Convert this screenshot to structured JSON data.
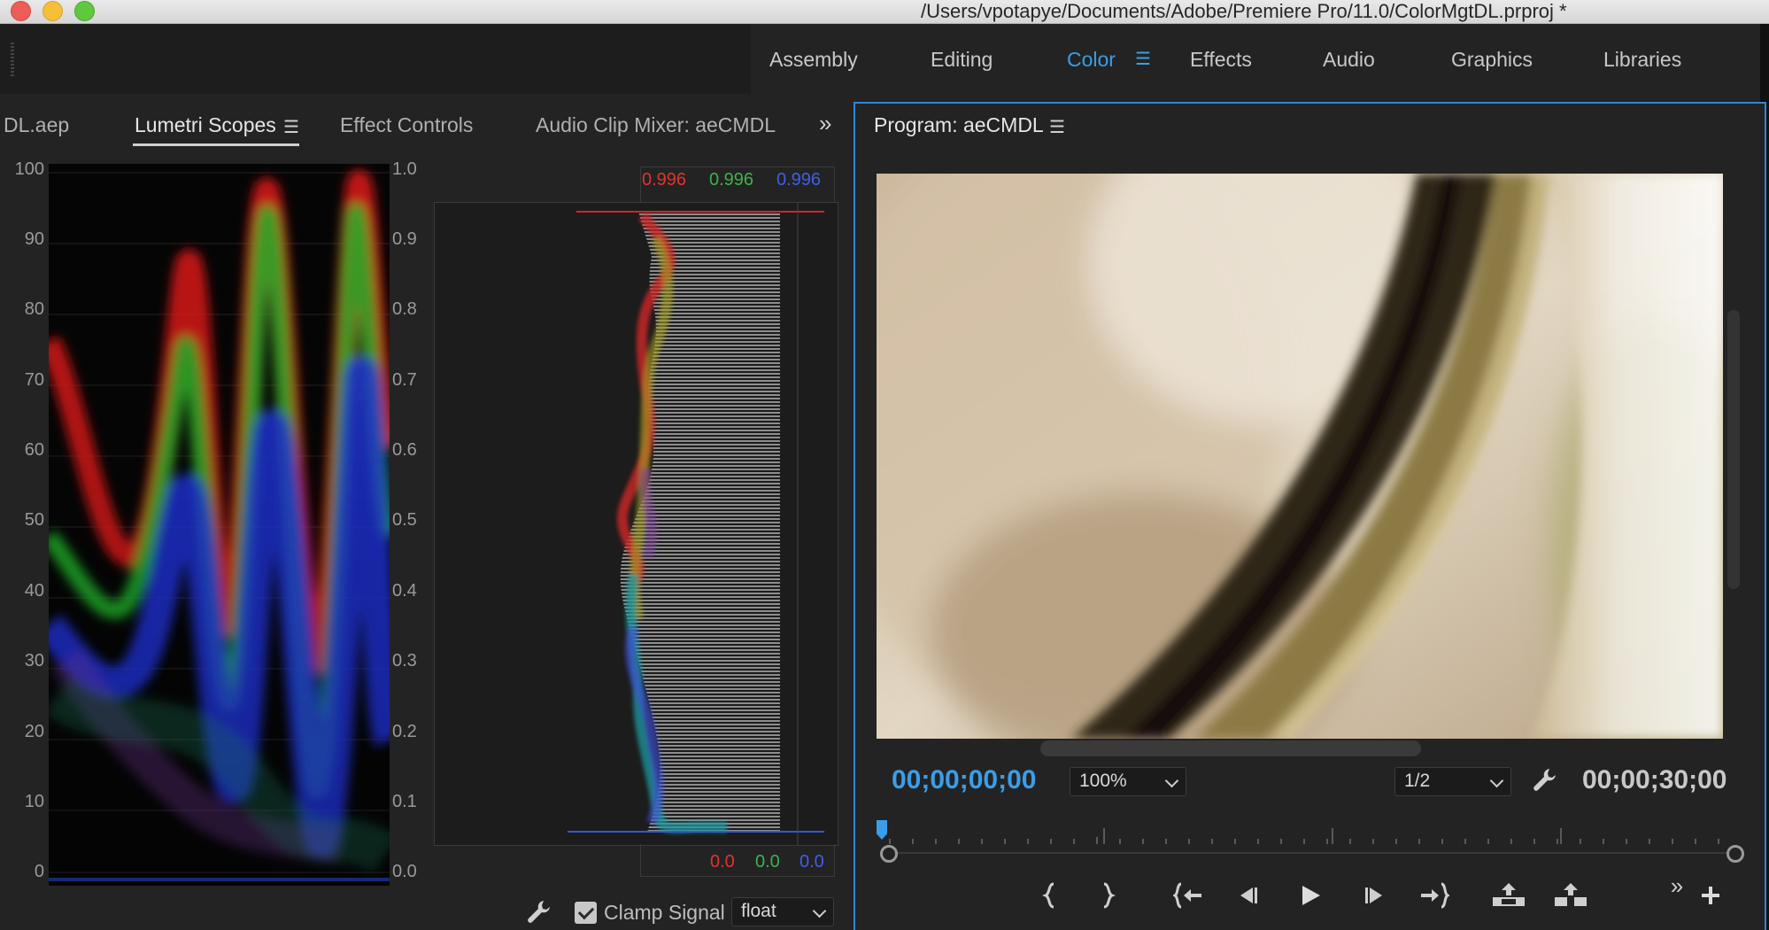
{
  "window": {
    "title": "/Users/vpotapye/Documents/Adobe/Premiere Pro/11.0/ColorMgtDL.prproj *"
  },
  "workspaces": {
    "items": [
      {
        "label": "Assembly"
      },
      {
        "label": "Editing"
      },
      {
        "label": "Color",
        "active": true
      },
      {
        "label": "Effects"
      },
      {
        "label": "Audio"
      },
      {
        "label": "Graphics"
      },
      {
        "label": "Libraries"
      }
    ],
    "menu_icon": "hamburger-icon",
    "accent_color": "#3a9ee8"
  },
  "left_panel": {
    "tabs": [
      {
        "label": "DL.aep"
      },
      {
        "label": "Lumetri Scopes",
        "active": true
      },
      {
        "label": "Effect Controls"
      },
      {
        "label": "Audio Clip Mixer: aeCMDL"
      }
    ],
    "overflow_icon": "double-chevron-right-icon",
    "waveform": {
      "left_axis": [
        "100",
        "90",
        "80",
        "70",
        "60",
        "50",
        "40",
        "30",
        "20",
        "10",
        "0"
      ],
      "right_axis": [
        "1.0",
        "0.9",
        "0.8",
        "0.7",
        "0.6",
        "0.5",
        "0.4",
        "0.3",
        "0.2",
        "0.1",
        "0.0"
      ]
    },
    "histogram": {
      "top_values": {
        "r": "0.996",
        "g": "0.996",
        "b": "0.996"
      },
      "bottom_values": {
        "r": "0.0",
        "g": "0.0",
        "b": "0.0"
      }
    },
    "footer": {
      "settings_icon": "wrench-icon",
      "clamp_label": "Clamp Signal",
      "clamp_checked": true,
      "precision_value": "float"
    }
  },
  "program_monitor": {
    "title": "Program: aeCMDL",
    "current_timecode": "00;00;00;00",
    "duration_timecode": "00;00;30;00",
    "zoom_value": "100%",
    "resolution_value": "1/2",
    "controls": [
      {
        "name": "mark-in-icon",
        "glyph": "{"
      },
      {
        "name": "mark-out-icon",
        "glyph": "}"
      },
      {
        "name": "go-to-in-icon",
        "glyph": "{←"
      },
      {
        "name": "step-back-icon",
        "glyph": "◀|"
      },
      {
        "name": "play-icon",
        "glyph": "▶"
      },
      {
        "name": "step-forward-icon",
        "glyph": "|▶"
      },
      {
        "name": "go-to-out-icon",
        "glyph": "→}"
      },
      {
        "name": "lift-icon",
        "glyph": "⇪"
      },
      {
        "name": "extract-icon",
        "glyph": "⇫"
      }
    ],
    "more_icon": "double-chevron-right-icon",
    "add_icon": "plus-icon"
  }
}
